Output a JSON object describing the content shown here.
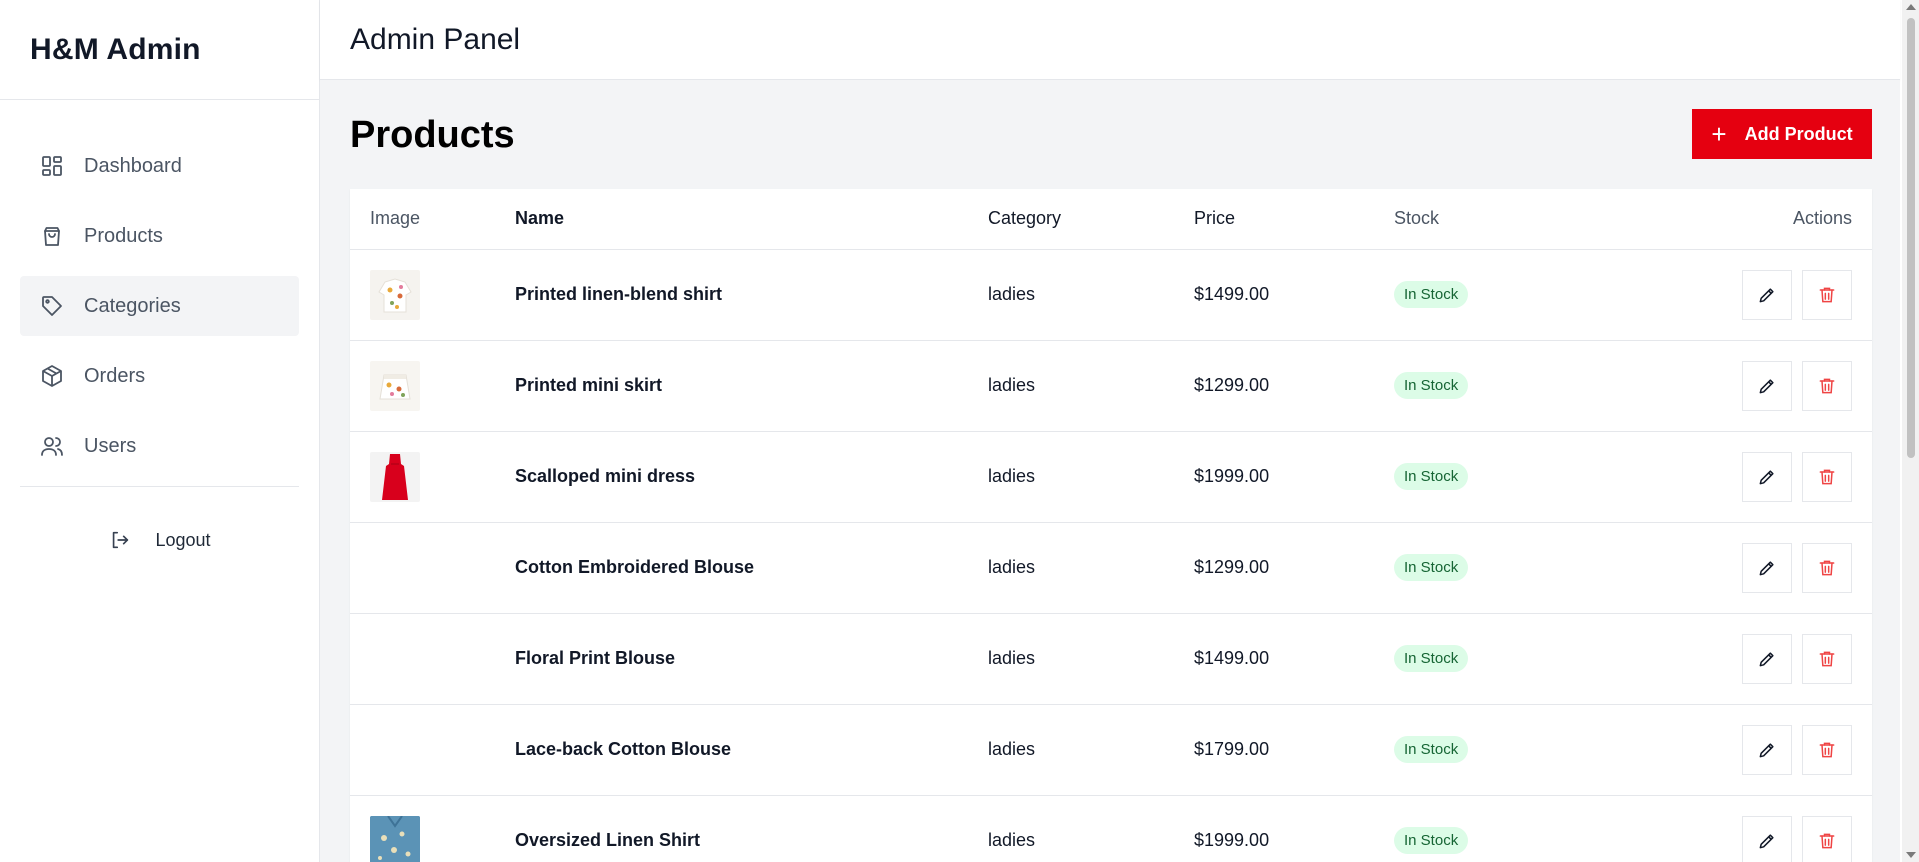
{
  "brand": {
    "title": "H&M Admin"
  },
  "header": {
    "title": "Admin Panel"
  },
  "sidebar": {
    "items": [
      {
        "label": "Dashboard",
        "icon": "dashboard-icon",
        "active": false
      },
      {
        "label": "Products",
        "icon": "shopping-bag-icon",
        "active": false
      },
      {
        "label": "Categories",
        "icon": "tag-icon",
        "active": true
      },
      {
        "label": "Orders",
        "icon": "package-icon",
        "active": false
      },
      {
        "label": "Users",
        "icon": "users-icon",
        "active": false
      }
    ],
    "logout": {
      "label": "Logout",
      "icon": "logout-icon"
    }
  },
  "main": {
    "page_title": "Products",
    "add_button": {
      "label": "Add Product",
      "icon": "plus-icon"
    },
    "table": {
      "columns": [
        "Image",
        "Name",
        "Category",
        "Price",
        "Stock",
        "Actions"
      ],
      "rows": [
        {
          "name": "Printed linen-blend shirt",
          "category": "ladies",
          "price": "$1499.00",
          "stock": "In Stock"
        },
        {
          "name": "Printed mini skirt",
          "category": "ladies",
          "price": "$1299.00",
          "stock": "In Stock"
        },
        {
          "name": "Scalloped mini dress",
          "category": "ladies",
          "price": "$1999.00",
          "stock": "In Stock"
        },
        {
          "name": "Cotton Embroidered Blouse",
          "category": "ladies",
          "price": "$1299.00",
          "stock": "In Stock"
        },
        {
          "name": "Floral Print Blouse",
          "category": "ladies",
          "price": "$1499.00",
          "stock": "In Stock"
        },
        {
          "name": "Lace-back Cotton Blouse",
          "category": "ladies",
          "price": "$1799.00",
          "stock": "In Stock"
        },
        {
          "name": "Oversized Linen Shirt",
          "category": "ladies",
          "price": "$1999.00",
          "stock": "In Stock"
        }
      ]
    }
  },
  "colors": {
    "accent": "#e50010",
    "active_bg": "#f3f4f6",
    "badge_bg": "#dcfce7",
    "badge_text": "#166534",
    "delete": "#ef4444"
  }
}
